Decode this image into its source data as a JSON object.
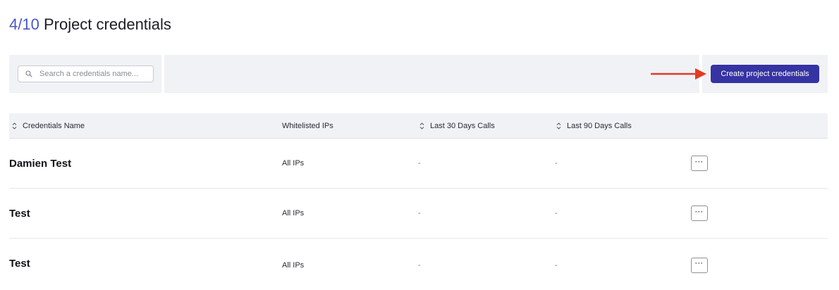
{
  "header": {
    "count": "4/10",
    "title": "Project credentials"
  },
  "toolbar": {
    "search_placeholder": "Search a credentials name...",
    "create_label": "Create project credentials"
  },
  "colors": {
    "accent": "#3633a3",
    "count_color": "#4a56c9",
    "annotation_arrow": "#e53a24"
  },
  "table": {
    "columns": [
      {
        "label": "Credentials Name",
        "sortable": true
      },
      {
        "label": "Whitelisted IPs",
        "sortable": false
      },
      {
        "label": "Last 30 Days Calls",
        "sortable": true
      },
      {
        "label": "Last 90 Days Calls",
        "sortable": true
      }
    ],
    "rows": [
      {
        "name": "Damien Test",
        "ips": "All IPs",
        "calls_30": "-",
        "calls_90": "-",
        "actions": "···"
      },
      {
        "name": "Test",
        "ips": "All IPs",
        "calls_30": "-",
        "calls_90": "-",
        "actions": "···"
      },
      {
        "name": "Test",
        "ips": "All IPs",
        "calls_30": "-",
        "calls_90": "-",
        "actions": "···"
      }
    ]
  }
}
